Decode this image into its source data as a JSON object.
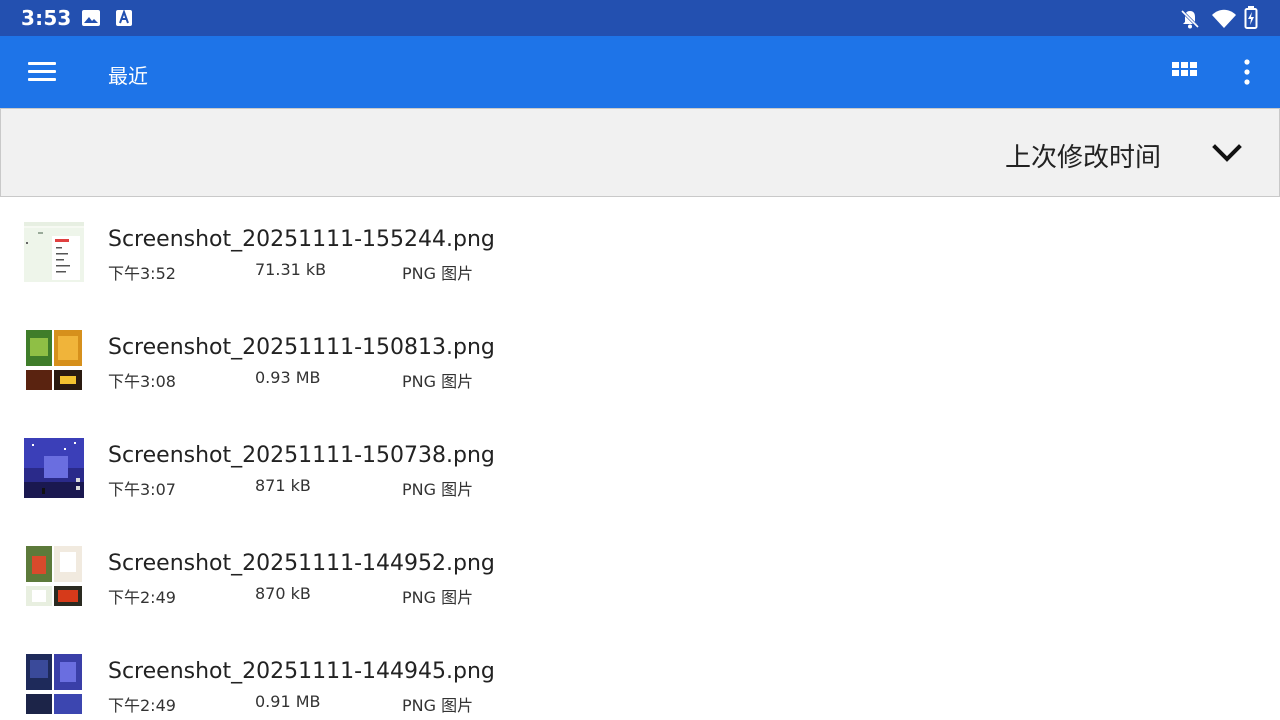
{
  "status_bar": {
    "time": "3:53",
    "left_icons": [
      "image-icon",
      "a-notification-icon"
    ],
    "right_icons": [
      "bell-off-icon",
      "wifi-icon",
      "battery-icon"
    ]
  },
  "app_bar": {
    "title": "最近",
    "menu_icon": "hamburger-icon",
    "view_icon": "grid-view-icon",
    "overflow_icon": "more-vert-icon"
  },
  "sort_bar": {
    "label": "上次修改时间",
    "icon": "chevron-down-icon"
  },
  "files": [
    {
      "name": "Screenshot_20251111-155244.png",
      "time": "下午3:52",
      "size": "71.31 kB",
      "type": "PNG 图片"
    },
    {
      "name": "Screenshot_20251111-150813.png",
      "time": "下午3:08",
      "size": "0.93 MB",
      "type": "PNG 图片"
    },
    {
      "name": "Screenshot_20251111-150738.png",
      "time": "下午3:07",
      "size": "871 kB",
      "type": "PNG 图片"
    },
    {
      "name": "Screenshot_20251111-144952.png",
      "time": "下午2:49",
      "size": "870 kB",
      "type": "PNG 图片"
    },
    {
      "name": "Screenshot_20251111-144945.png",
      "time": "下午2:49",
      "size": "0.91 MB",
      "type": "PNG 图片"
    }
  ],
  "colors": {
    "status_bar": "#2350b0",
    "app_bar": "#1e74e8",
    "sort_bar": "#f1f1f1"
  }
}
